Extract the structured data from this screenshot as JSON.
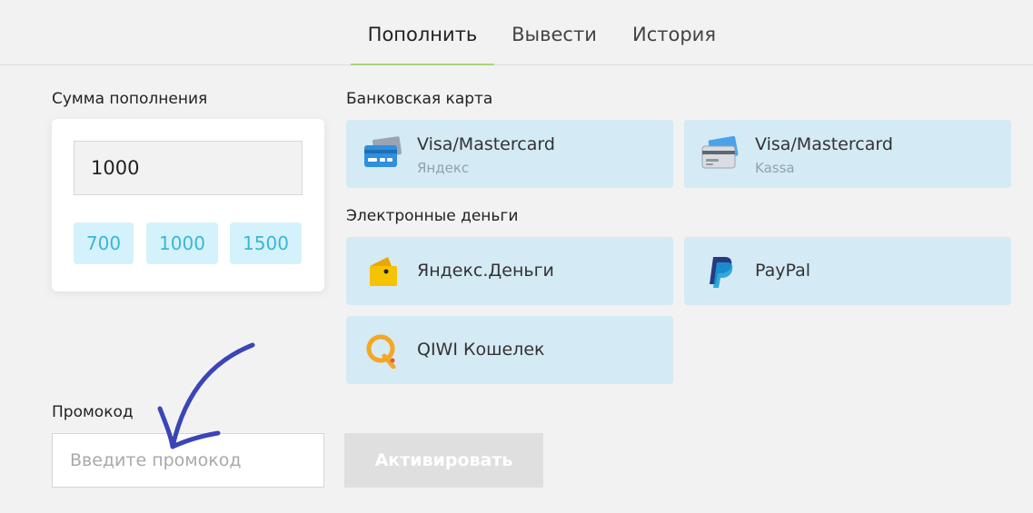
{
  "tabs": [
    {
      "label": "Пополнить",
      "active": true
    },
    {
      "label": "Вывести",
      "active": false
    },
    {
      "label": "История",
      "active": false
    }
  ],
  "amount": {
    "label": "Сумма пополнения",
    "value": "1000",
    "presets": [
      "700",
      "1000",
      "1500"
    ]
  },
  "bank_card": {
    "label": "Банковская карта",
    "methods": [
      {
        "name": "Visa/Mastercard",
        "provider": "Яндекс",
        "icon": "bank-card-icon"
      },
      {
        "name": "Visa/Mastercard",
        "provider": "Kassa",
        "icon": "credit-card-icon"
      }
    ]
  },
  "emoney": {
    "label": "Электронные деньги",
    "methods": [
      {
        "name": "Яндекс.Деньги",
        "icon": "yandex-money-wallet-icon"
      },
      {
        "name": "PayPal",
        "icon": "paypal-icon"
      },
      {
        "name": "QIWI Кошелек",
        "icon": "qiwi-icon"
      }
    ]
  },
  "promo": {
    "label": "Промокод",
    "placeholder": "Введите промокод",
    "value": "",
    "activate_label": "Активировать"
  },
  "colors": {
    "background": "#f2f2f2",
    "tile": "#d4eaf4",
    "preset": "#d4f2fb",
    "preset_text": "#3ab6d6",
    "active_tab_underline": "#a9d67a",
    "annotation_arrow": "#3a45b8"
  }
}
